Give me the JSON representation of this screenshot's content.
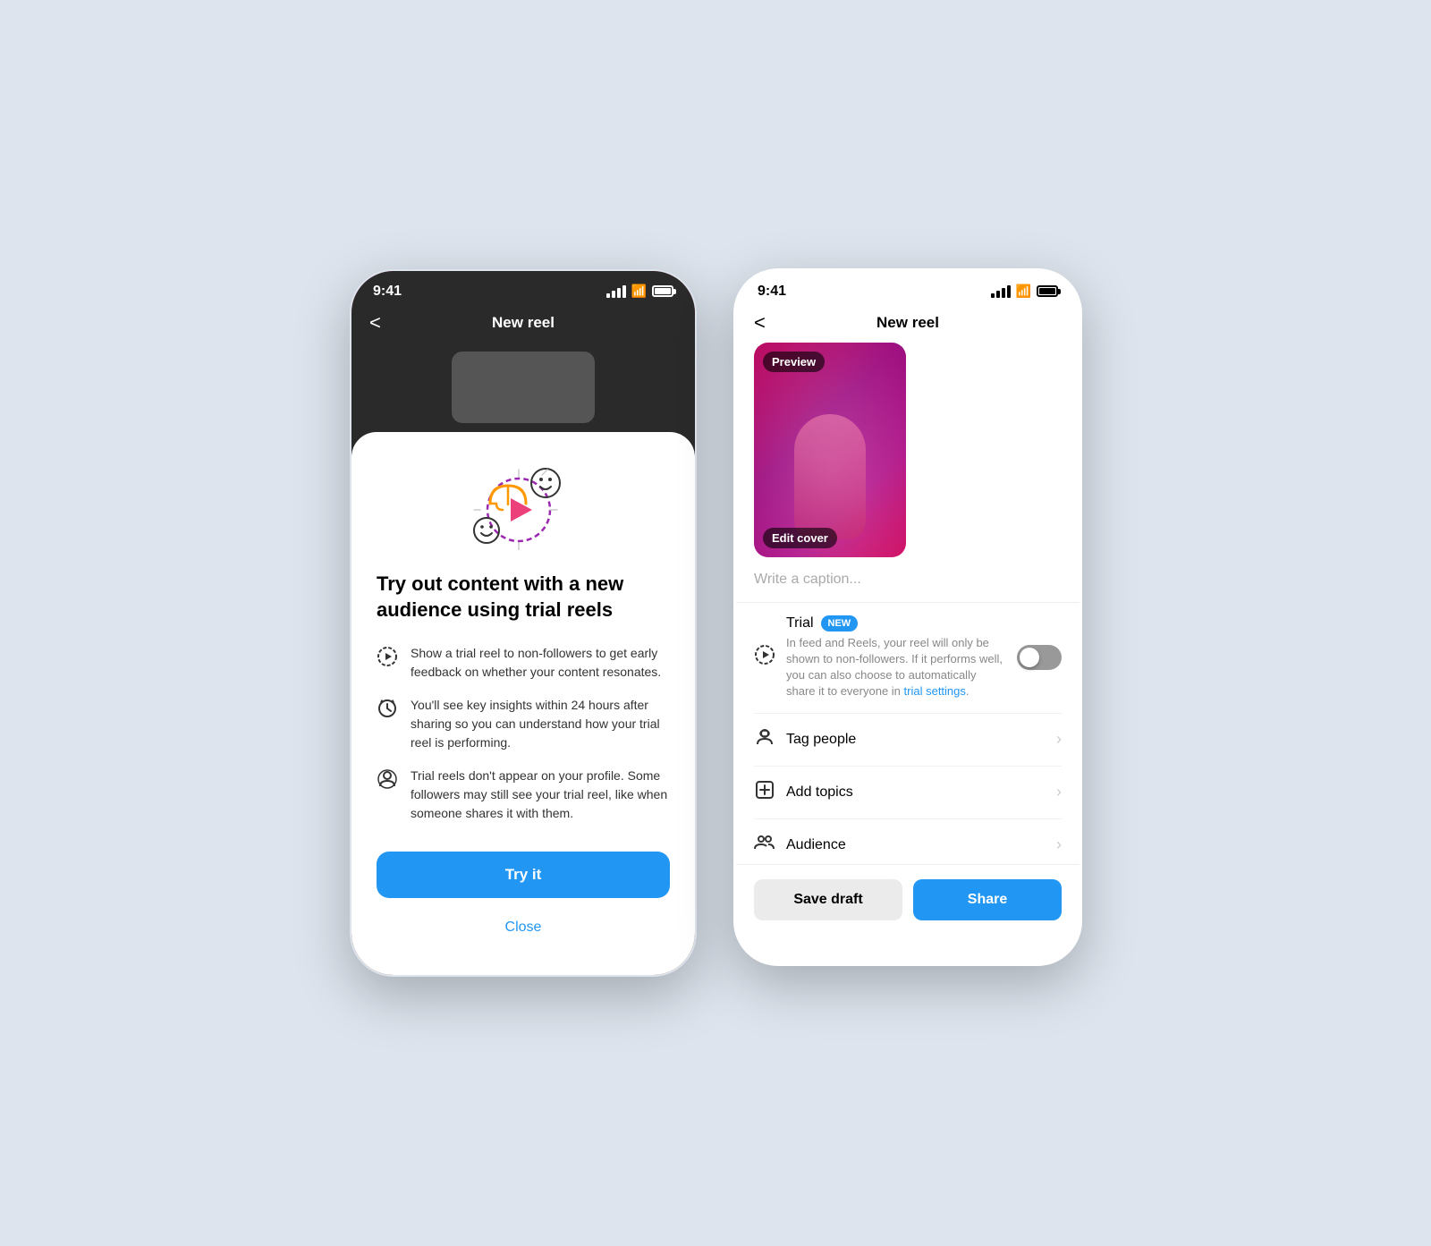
{
  "page": {
    "background": "#dde4ed"
  },
  "left_phone": {
    "status_bar": {
      "time": "9:41"
    },
    "nav": {
      "title": "New reel",
      "back_label": "<"
    },
    "modal": {
      "title": "Try out content with a new audience using trial reels",
      "features": [
        {
          "icon": "🎬",
          "text": "Show a trial reel to non-followers to get early feedback on whether your content resonates."
        },
        {
          "icon": "⏰",
          "text": "You'll see key insights within 24 hours after sharing so you can understand how your trial reel is performing."
        },
        {
          "icon": "👤",
          "text": "Trial reels don't appear on your profile. Some followers may still see your trial reel, like when someone shares it with them."
        }
      ],
      "try_it_label": "Try it",
      "close_label": "Close"
    }
  },
  "right_phone": {
    "status_bar": {
      "time": "9:41"
    },
    "nav": {
      "title": "New reel",
      "back_label": "<"
    },
    "video": {
      "preview_badge": "Preview",
      "edit_cover_badge": "Edit cover"
    },
    "caption_placeholder": "Write a caption...",
    "trial_section": {
      "icon": "🎬",
      "title": "Trial",
      "new_badge": "NEW",
      "description": "In feed and Reels, your reel will only be shown to non-followers. If it performs well, you can also choose to automatically share it to everyone in ",
      "link_text": "trial settings",
      "description_end": "."
    },
    "tag_people": {
      "icon": "👤",
      "label": "Tag people",
      "chevron": "›"
    },
    "add_topics": {
      "icon": "#",
      "label": "Add topics",
      "chevron": "›"
    },
    "audience": {
      "icon": "👥",
      "label": "Audience",
      "chevron": "›"
    },
    "actions": {
      "save_draft": "Save draft",
      "share": "Share"
    }
  }
}
